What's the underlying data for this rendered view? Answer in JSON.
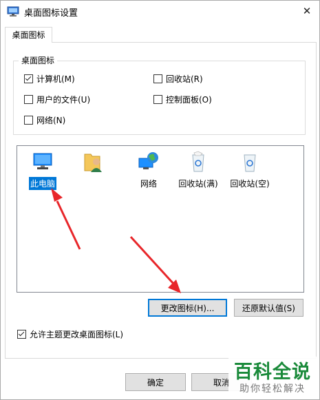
{
  "window": {
    "title": "桌面图标设置",
    "close_glyph": "✕"
  },
  "tabs": [
    {
      "label": "桌面图标"
    }
  ],
  "group": {
    "title": "桌面图标",
    "checkboxes": [
      {
        "label": "计算机(M)",
        "checked": true
      },
      {
        "label": "回收站(R)",
        "checked": false
      },
      {
        "label": "用户的文件(U)",
        "checked": false
      },
      {
        "label": "控制面板(O)",
        "checked": false
      },
      {
        "label": "网络(N)",
        "checked": false
      }
    ]
  },
  "icons": [
    {
      "label": "此电脑",
      "icon": "this-pc-icon",
      "selected": true
    },
    {
      "label": "",
      "icon": "user-files-icon",
      "selected": false
    },
    {
      "label": "网络",
      "icon": "network-icon",
      "selected": false
    },
    {
      "label": "回收站(满)",
      "icon": "recycle-bin-full-icon",
      "selected": false
    },
    {
      "label": "回收站(空)",
      "icon": "recycle-bin-empty-icon",
      "selected": false
    }
  ],
  "buttons": {
    "change_icon": "更改图标(H)...",
    "restore_default": "还原默认值(S)",
    "ok": "确定",
    "cancel": "取消"
  },
  "allow_themes": {
    "label": "允许主题更改桌面图标(L)",
    "checked": true
  },
  "watermark": {
    "main": "百科全说",
    "sub": "助你轻松解决"
  },
  "colors": {
    "selection": "#0078d7",
    "arrow": "#e8262a",
    "watermark": "#1a8a3a"
  }
}
